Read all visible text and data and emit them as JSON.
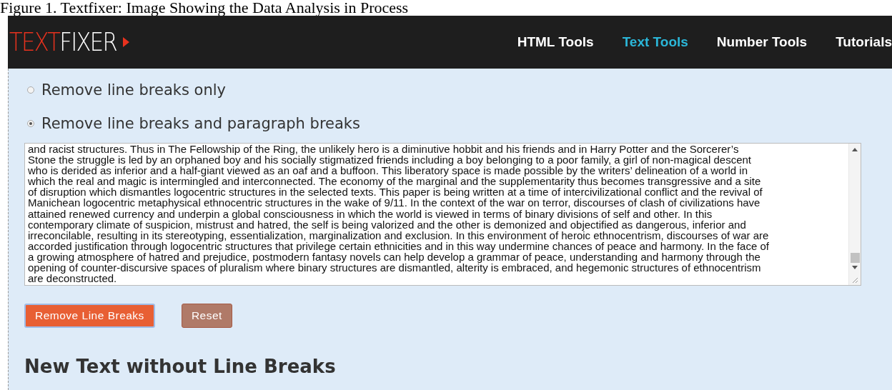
{
  "caption": "Figure 1. Textfixer: Image Showing the Data Analysis in Process",
  "logo": {
    "parts": [
      {
        "text": "TEXT",
        "color": "#e8321e"
      },
      {
        "text": "FIXER",
        "color": "#ffffff"
      }
    ]
  },
  "nav": [
    {
      "label": "HTML Tools",
      "selected": false
    },
    {
      "label": "Text Tools",
      "selected": true
    },
    {
      "label": "Number Tools",
      "selected": false
    },
    {
      "label": "Tutorials",
      "selected": false
    }
  ],
  "options": [
    {
      "label": "Remove line breaks only",
      "selected": false
    },
    {
      "label": "Remove line breaks and paragraph breaks",
      "selected": true
    }
  ],
  "text_area": {
    "lines": [
      "and racist structures. Thus in The Fellowship of the Ring, the unlikely hero is a diminutive hobbit and his friends and in Harry Potter and the Sorcerer’s",
      "Stone the struggle is led by an orphaned boy and his socially stigmatized friends including a boy belonging to a poor family, a girl of non-magical descent",
      "who is derided as inferior and a half-giant viewed as an oaf and a buffoon. This liberatory space is made possible by the writers’ delineation of a world in",
      "which the real and magic is intermingled and interconnected. The economy of the marginal and the supplementarity thus becomes transgressive and a site",
      "of disruption which dismantles logocentric structures in the selected texts. This paper is being written at a time of intercivilizational conflict and the revival of",
      "Manichean logocentric metaphysical ethnocentric structures in the wake of 9/11. In the context of the war on terror, discourses of clash of civilizations have",
      "attained renewed currency and underpin a global consciousness in which the world is viewed in terms of binary divisions of self and other. In this",
      "contemporary climate of suspicion, mistrust and hatred, the self is being valorized and the other is demonized and objectified as dangerous, inferior and",
      "irreconcilable, resulting in its stereotyping, essentialization, marginalization and exclusion. In this environment of heroic ethnocentrism, discourses of war are",
      "accorded justification through logocentric structures that privilege certain ethnicities and in this way undermine chances of peace and harmony. In the face of",
      "a growing atmosphere of hatred and prejudice, postmodern fantasy novels can help develop a grammar of peace, understanding and harmony through the",
      "opening of counter-discursive spaces of pluralism where binary structures are dismantled, alterity is embraced, and hegemonic structures of ethnocentrism",
      "are deconstructed."
    ]
  },
  "buttons": [
    {
      "label": "Remove Line Breaks",
      "kind": "primary"
    },
    {
      "label": "Reset",
      "kind": "secondary"
    }
  ],
  "heading": "New Text without Line Breaks"
}
